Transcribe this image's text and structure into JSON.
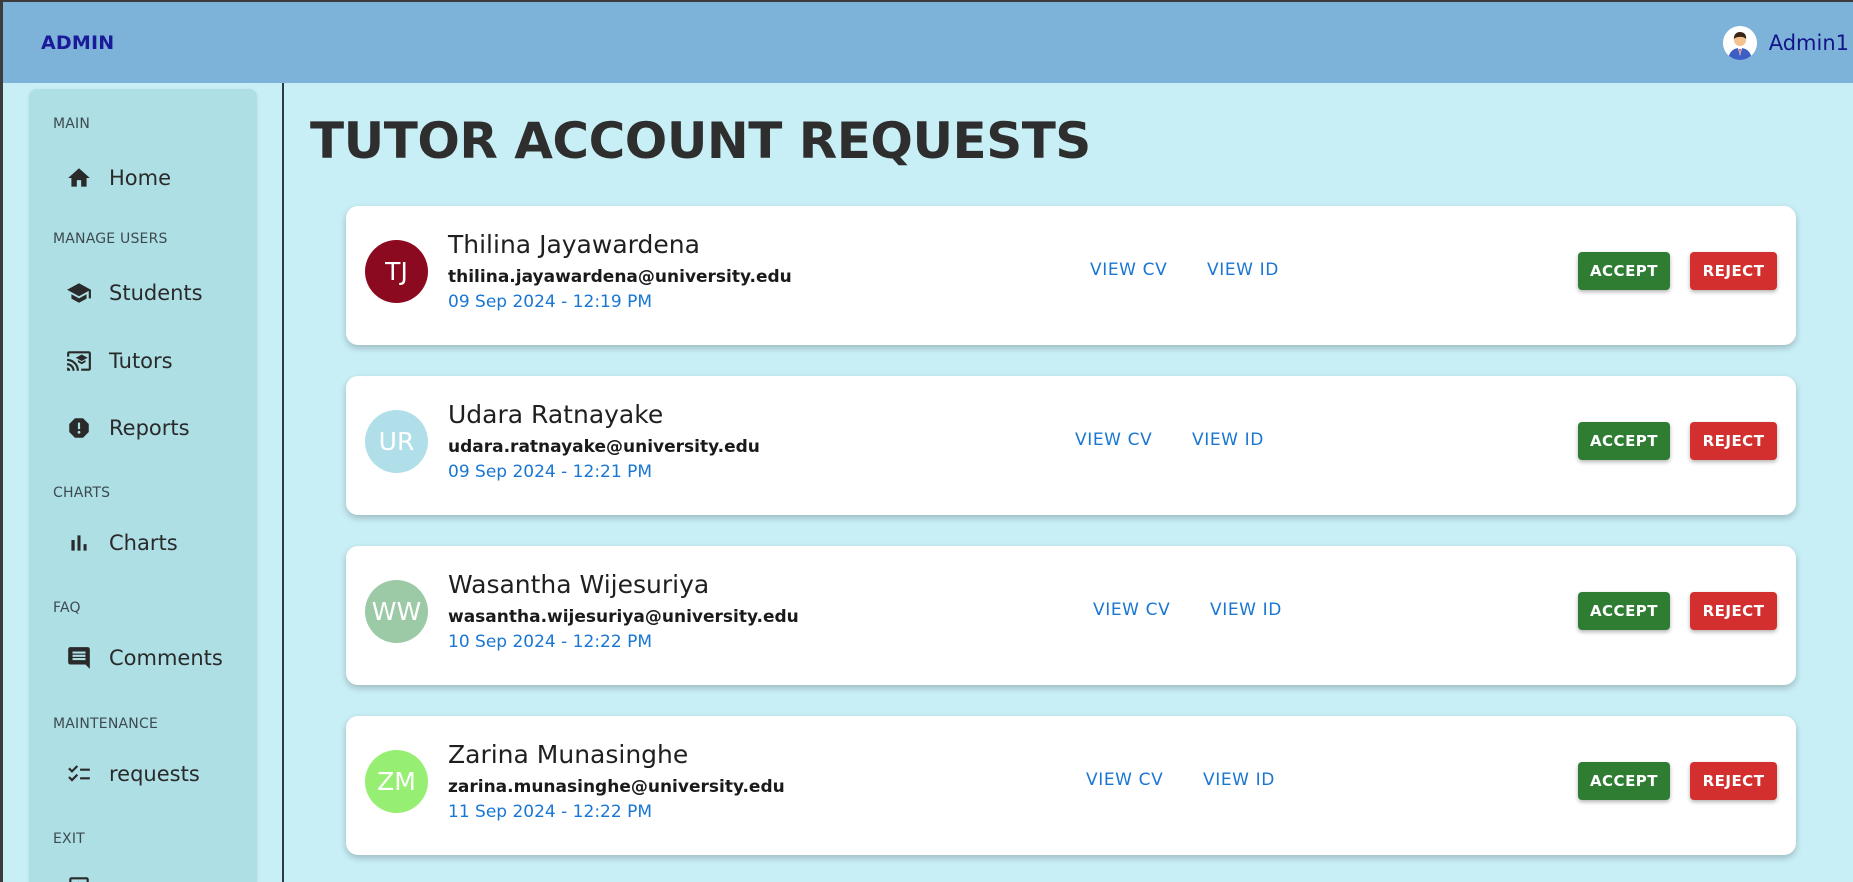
{
  "header": {
    "brand": "ADMIN",
    "user_name": "Admin1",
    "user_avatar_icon": "user-avatar-icon"
  },
  "sidebar": {
    "sections": [
      {
        "label": "MAIN",
        "items": [
          {
            "label": "Home",
            "icon": "home-icon"
          }
        ]
      },
      {
        "label": "MANAGE USERS",
        "items": [
          {
            "label": "Students",
            "icon": "graduation-cap-icon"
          },
          {
            "label": "Tutors",
            "icon": "cast-for-education-icon"
          },
          {
            "label": "Reports",
            "icon": "report-icon"
          }
        ]
      },
      {
        "label": "CHARTS",
        "items": [
          {
            "label": "Charts",
            "icon": "bar-chart-icon"
          }
        ]
      },
      {
        "label": "FAQ",
        "items": [
          {
            "label": "Comments",
            "icon": "comment-icon"
          }
        ]
      },
      {
        "label": "MAINTENANCE",
        "items": [
          {
            "label": "requests",
            "icon": "checklist-icon"
          }
        ]
      },
      {
        "label": "EXIT",
        "items": []
      }
    ]
  },
  "main": {
    "title": "TUTOR ACCOUNT REQUESTS",
    "requests": [
      {
        "initials": "TJ",
        "avatar_color": "#8b0a1f",
        "name": "Thilina Jayawardena",
        "email": "thilina.jayawardena@university.edu",
        "date": "09 Sep 2024 - 12:19 PM",
        "view_cv": "VIEW CV",
        "view_id": "VIEW ID",
        "accept": "ACCEPT",
        "reject": "REJECT"
      },
      {
        "initials": "UR",
        "avatar_color": "#b0dfe9",
        "name": "Udara Ratnayake",
        "email": "udara.ratnayake@university.edu",
        "date": "09 Sep 2024 - 12:21 PM",
        "view_cv": "VIEW CV",
        "view_id": "VIEW ID",
        "accept": "ACCEPT",
        "reject": "REJECT"
      },
      {
        "initials": "WW",
        "avatar_color": "#9cc9a6",
        "name": "Wasantha Wijesuriya",
        "email": "wasantha.wijesuriya@university.edu",
        "date": "10 Sep 2024 - 12:22 PM",
        "view_cv": "VIEW CV",
        "view_id": "VIEW ID",
        "accept": "ACCEPT",
        "reject": "REJECT"
      },
      {
        "initials": "ZM",
        "avatar_color": "#96ef72",
        "name": "Zarina Munasinghe",
        "email": "zarina.munasinghe@university.edu",
        "date": "11 Sep 2024 - 12:22 PM",
        "view_cv": "VIEW CV",
        "view_id": "VIEW ID",
        "accept": "ACCEPT",
        "reject": "REJECT"
      }
    ]
  },
  "colors": {
    "appbar": "#7db3d8",
    "background": "#c8eef6",
    "sidebar": "#addfe5",
    "accept": "#2e7d32",
    "reject": "#d32f2f",
    "link": "#1976d2"
  }
}
